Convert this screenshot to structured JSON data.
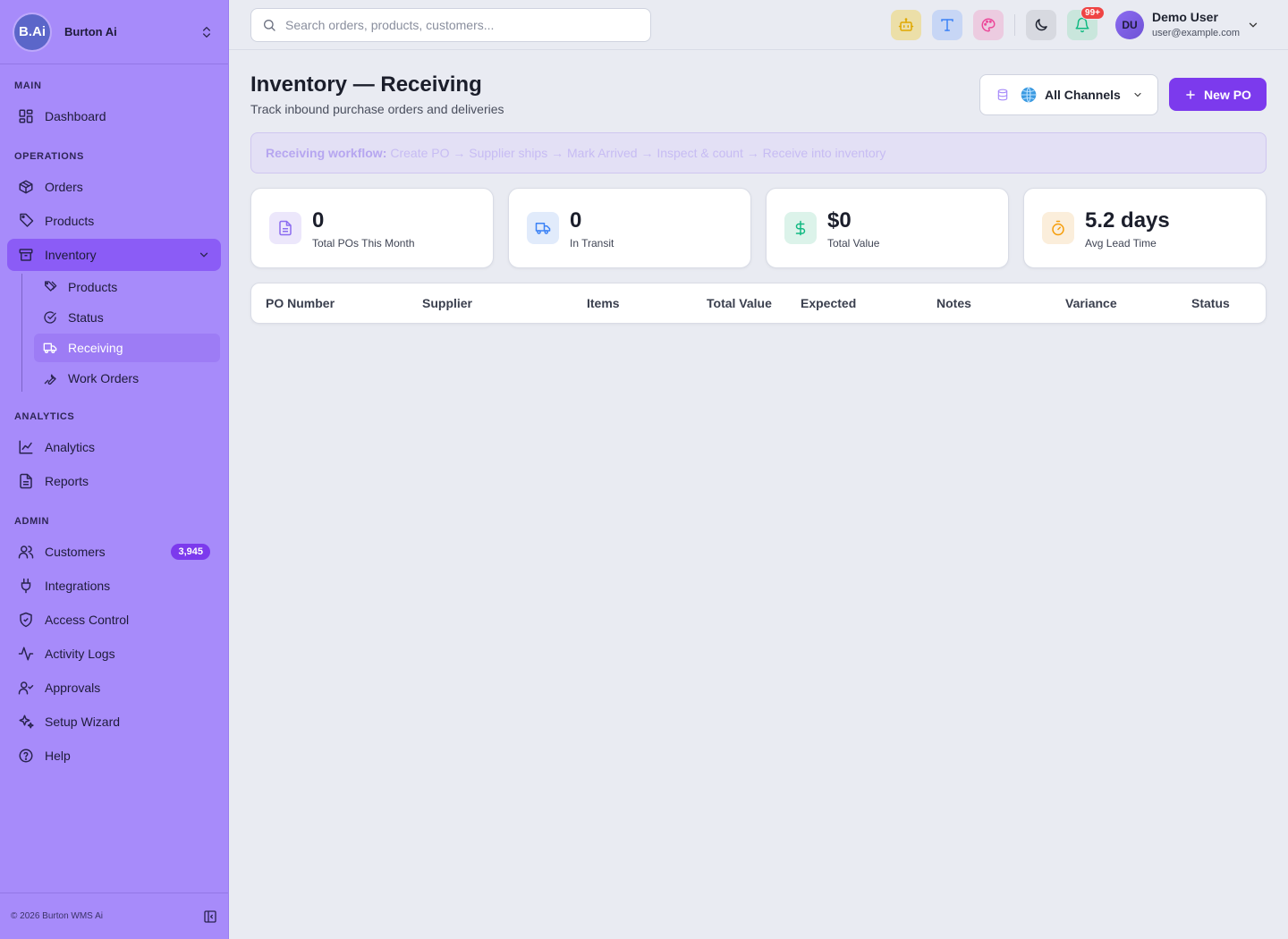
{
  "brand": {
    "logo_text": "B.Ai",
    "name": "Burton Ai"
  },
  "sidebar": {
    "sections": {
      "main": "MAIN",
      "operations": "OPERATIONS",
      "analytics": "ANALYTICS",
      "admin": "ADMIN"
    },
    "items": {
      "dashboard": "Dashboard",
      "orders": "Orders",
      "products": "Products",
      "inventory": "Inventory",
      "analytics": "Analytics",
      "reports": "Reports",
      "customers": "Customers",
      "customers_badge": "3,945",
      "integrations": "Integrations",
      "access_control": "Access Control",
      "activity_logs": "Activity Logs",
      "approvals": "Approvals",
      "setup_wizard": "Setup Wizard",
      "help": "Help"
    },
    "inventory_sub": {
      "products": "Products",
      "status": "Status",
      "receiving": "Receiving",
      "work_orders": "Work Orders"
    },
    "footer": "© 2026 Burton WMS Ai"
  },
  "topbar": {
    "search_placeholder": "Search orders, products, customers...",
    "notif_badge": "99+",
    "user": {
      "initials": "DU",
      "name": "Demo User",
      "email": "user@example.com"
    }
  },
  "page": {
    "title": "Inventory — Receiving",
    "subtitle": "Track inbound purchase orders and deliveries",
    "channel": "All Channels",
    "new_po": "New PO",
    "workflow_label": "Receiving workflow:",
    "workflow_steps": "Create PO → Supplier ships → Mark Arrived → Inspect & count → Receive into inventory"
  },
  "stats": [
    {
      "value": "0",
      "label": "Total POs This Month"
    },
    {
      "value": "0",
      "label": "In Transit"
    },
    {
      "value": "$0",
      "label": "Total Value"
    },
    {
      "value": "5.2 days",
      "label": "Avg Lead Time"
    }
  ],
  "table": {
    "columns": [
      "PO Number",
      "Supplier",
      "Items",
      "Total Value",
      "Expected",
      "Notes",
      "Variance",
      "Status"
    ]
  },
  "colors": {
    "accent": "#7c3aed",
    "sidebar": "#a78bfa",
    "active_nav": "#8b5cf6"
  }
}
